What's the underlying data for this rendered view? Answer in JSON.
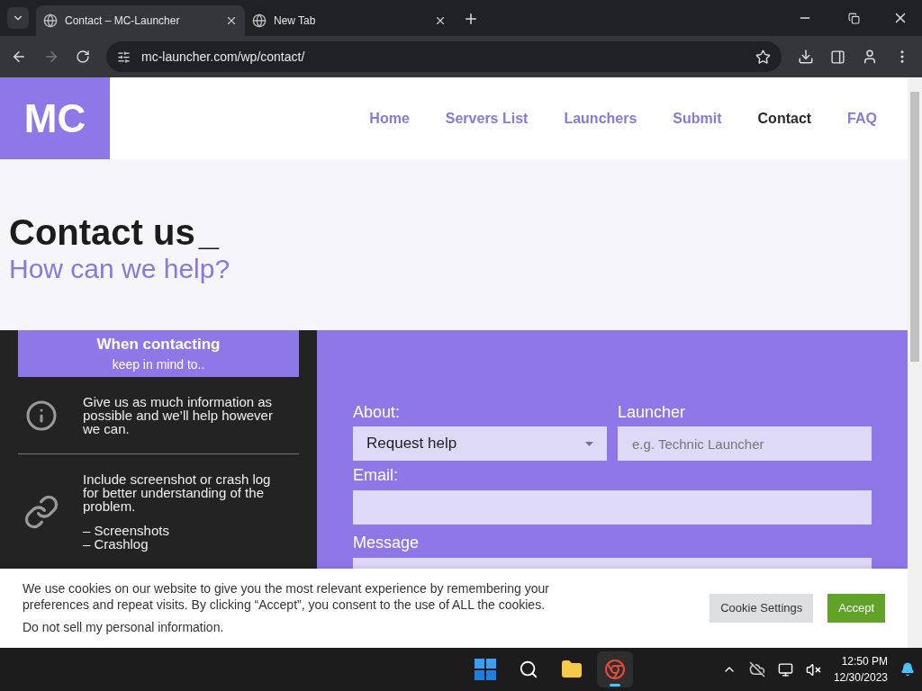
{
  "browser": {
    "tabs": [
      {
        "title": "Contact – MC-Launcher",
        "selected": true
      },
      {
        "title": "New Tab",
        "selected": false
      }
    ],
    "url": "mc-launcher.com/wp/contact/"
  },
  "site": {
    "logo": "MC",
    "nav": [
      {
        "label": "Home",
        "selected": false
      },
      {
        "label": "Servers List",
        "selected": false
      },
      {
        "label": "Launchers",
        "selected": false
      },
      {
        "label": "Submit",
        "selected": false
      },
      {
        "label": "Contact",
        "selected": true
      },
      {
        "label": "FAQ",
        "selected": false
      }
    ],
    "hero": {
      "title": "Contact us",
      "cursor": "_",
      "subtitle": "How can we help?"
    },
    "tips": {
      "heading": "When contacting",
      "subheading": "keep in mind to..",
      "items": [
        {
          "kind": "info",
          "text": "Give us as much information as possible and we’ll help however we can."
        },
        {
          "kind": "link",
          "text": "Include screenshot or crash log for better understanding of the problem.",
          "bullets": [
            "– Screenshots",
            "– Crashlog"
          ]
        }
      ]
    },
    "form": {
      "about": {
        "label": "About:",
        "value": "Request help"
      },
      "launcher": {
        "label": "Launcher",
        "placeholder": "e.g. Technic Launcher"
      },
      "email": {
        "label": "Email:"
      },
      "message": {
        "label": "Message"
      }
    },
    "cookie": {
      "text": "We use cookies on our website to give you the most relevant experience by remembering your preferences and repeat visits. By clicking “Accept”, you consent to the use of ALL the cookies.",
      "link": "Do not sell my personal information.",
      "settings": "Cookie Settings",
      "accept": "Accept"
    }
  },
  "taskbar": {
    "apps": [
      {
        "kind": "start",
        "selected": false
      },
      {
        "kind": "search",
        "selected": false
      },
      {
        "kind": "files",
        "selected": false
      },
      {
        "kind": "chrome",
        "selected": true
      }
    ],
    "time": "12:50 PM",
    "date": "12/30/2023"
  }
}
